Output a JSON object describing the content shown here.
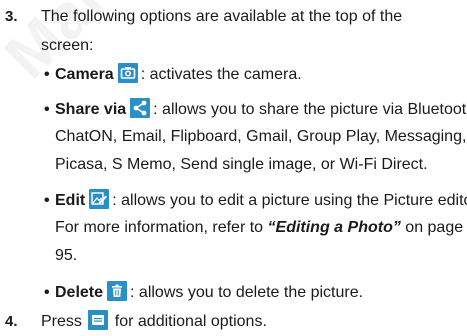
{
  "step3": {
    "number": "3.",
    "line1": "The following options are available at the top of the",
    "line2": "screen:"
  },
  "options": {
    "camera": {
      "title": "Camera",
      "icon": "camera-icon",
      "desc": ": activates the camera."
    },
    "share": {
      "title": "Share via",
      "icon": "share-icon",
      "desc1": ": allows you to share the picture via Bluetooth,",
      "desc2": "ChatON, Email, Flipboard, Gmail, Group Play, Messaging,",
      "desc3": "Picasa, S Memo, Send single image, or Wi-Fi Direct."
    },
    "edit": {
      "title": "Edit",
      "icon": "edit-icon",
      "desc1": ": allows you to edit a picture using the Picture editor.",
      "desc2_pre": "For more information, refer to ",
      "desc2_link": "“Editing a Photo”",
      "desc2_post": " on page",
      "desc3": "95."
    },
    "delete": {
      "title": "Delete",
      "icon": "trash-icon",
      "desc": ": allows you to delete the picture."
    }
  },
  "step4": {
    "number": "4.",
    "pre": "Press ",
    "icon": "menu-icon",
    "post": " for additional options."
  },
  "watermark": "Manual Use",
  "colors": {
    "icon_bg": "#2b8fc7",
    "text": "#1a1a1a"
  }
}
